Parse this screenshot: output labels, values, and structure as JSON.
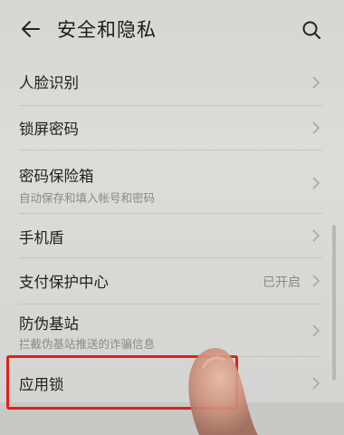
{
  "header": {
    "title": "安全和隐私",
    "back_icon": "arrow-left-icon",
    "search_icon": "search-icon"
  },
  "items": [
    {
      "label": "人脸识别",
      "sub": "",
      "status": ""
    },
    {
      "label": "锁屏密码",
      "sub": "",
      "status": ""
    },
    {
      "label": "密码保险箱",
      "sub": "自动保存和填入帐号和密码",
      "status": ""
    },
    {
      "label": "手机盾",
      "sub": "",
      "status": ""
    },
    {
      "label": "支付保护中心",
      "sub": "",
      "status": "已开启"
    },
    {
      "label": "防伪基站",
      "sub": "拦截伪基站推送的诈骗信息",
      "status": ""
    },
    {
      "label": "应用锁",
      "sub": "",
      "status": ""
    }
  ],
  "colors": {
    "background": "#d6d6d4",
    "highlight": "#e0201c",
    "chevron": "#a8a8a6"
  }
}
